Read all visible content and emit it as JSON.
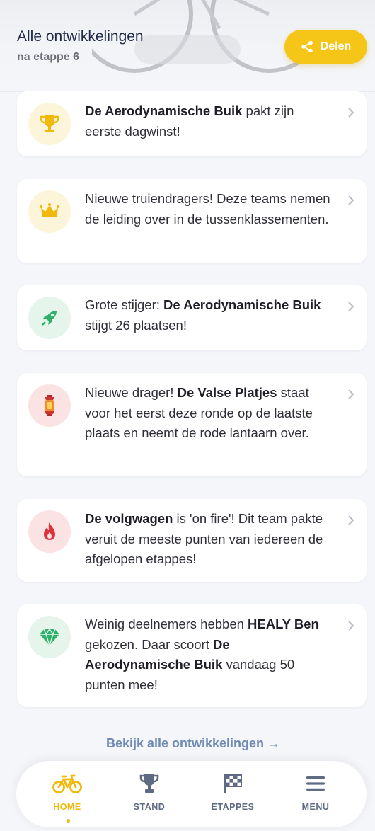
{
  "header": {
    "title": "Alle ontwikkelingen",
    "subtitle": "na etappe 6",
    "share_label": "Delen"
  },
  "cards": [
    {
      "icon": "trophy-icon",
      "parts": [
        {
          "t": "De Aerodynamische Buik",
          "b": true
        },
        {
          "t": " pakt zijn eerste dagwinst!",
          "b": false
        }
      ]
    },
    {
      "icon": "crown-icon",
      "parts": [
        {
          "t": "Nieuwe truiendragers! Deze teams nemen de leiding over in de tussenklassementen.",
          "b": false
        }
      ]
    },
    {
      "icon": "rocket-icon",
      "parts": [
        {
          "t": "Grote stijger: ",
          "b": false
        },
        {
          "t": "De Aerodynamische Buik",
          "b": true
        },
        {
          "t": " stijgt 26 plaatsen!",
          "b": false
        }
      ]
    },
    {
      "icon": "lantern-icon",
      "parts": [
        {
          "t": "Nieuwe drager! ",
          "b": false
        },
        {
          "t": "De Valse Platjes",
          "b": true
        },
        {
          "t": " staat voor het eerst deze ronde op de laatste plaats en neemt de rode lantaarn over.",
          "b": false
        }
      ]
    },
    {
      "icon": "fire-icon",
      "parts": [
        {
          "t": "De volgwagen",
          "b": true
        },
        {
          "t": " is 'on fire'! Dit team pakte veruit de meeste punten van iedereen de afgelopen etappes!",
          "b": false
        }
      ]
    },
    {
      "icon": "diamond-icon",
      "parts": [
        {
          "t": "Weinig deelnemers hebben ",
          "b": false
        },
        {
          "t": "HEALY Ben",
          "b": true
        },
        {
          "t": " gekozen. Daar scoort ",
          "b": false
        },
        {
          "t": "De Aerodynamische Buik",
          "b": true
        },
        {
          "t": " vandaag 50 punten mee!",
          "b": false
        }
      ]
    }
  ],
  "all_link": "Bekijk alle ontwikkelingen →",
  "nav": {
    "items": [
      {
        "label": "HOME",
        "icon": "bicycle-icon",
        "active": true
      },
      {
        "label": "STAND",
        "icon": "trophy-icon",
        "active": false
      },
      {
        "label": "ETAPPES",
        "icon": "checkered-flag-icon",
        "active": false
      },
      {
        "label": "MENU",
        "icon": "hamburger-menu-icon",
        "active": false
      }
    ]
  },
  "colors": {
    "accent": "#f5c518",
    "nav_active": "#f0b90b",
    "nav_inactive": "#5e6b82",
    "link": "#6f8bb3",
    "badge_yellow": "#fdf5d9",
    "badge_green": "#e6f5ec",
    "badge_red": "#fbe3e3"
  }
}
